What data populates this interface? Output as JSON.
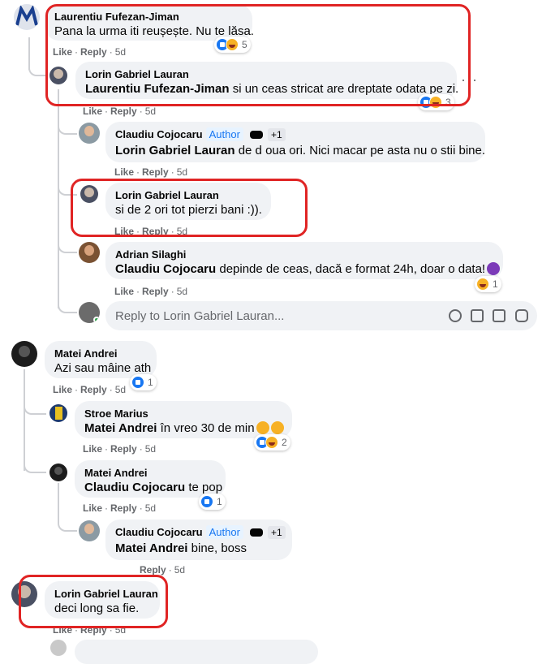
{
  "common": {
    "like": "Like",
    "reply": "Reply",
    "dot": "·"
  },
  "comments": [
    {
      "name": "Laurentiu Fufezan-Jiman",
      "text": "Pana la urma iti reușește. Nu te lăsa.",
      "time": "5d",
      "reactions": "5"
    },
    {
      "name": "Lorin Gabriel Lauran",
      "tag": "Laurentiu Fufezan-Jiman",
      "text": "si un ceas stricat are dreptate odata pe zi.",
      "time": "5d",
      "reactions": "3"
    },
    {
      "name": "Claudiu Cojocaru",
      "author": "Author",
      "badge": "+1",
      "tag": "Lorin Gabriel Lauran",
      "text": "de d oua ori. Nici macar pe asta nu o stii bine.",
      "time": "5d"
    },
    {
      "name": "Lorin Gabriel Lauran",
      "text": "si de 2 ori tot pierzi bani :)).",
      "time": "5d"
    },
    {
      "name": "Adrian Silaghi",
      "tag": "Claudiu Cojocaru",
      "text": "depinde de ceas, dacă e format 24h, doar o data!",
      "time": "5d",
      "reactions": "1"
    },
    {
      "name": "Matei Andrei",
      "text": "Azi sau mâine ath",
      "time": "5d",
      "reactions": "1"
    },
    {
      "name": "Stroe Marius",
      "tag": "Matei Andrei",
      "text": "în vreo 30 de min",
      "time": "5d",
      "reactions": "2"
    },
    {
      "name": "Matei Andrei",
      "tag": "Claudiu Cojocaru",
      "text": "te pop",
      "time": "5d",
      "reactions": "1"
    },
    {
      "name": "Claudiu Cojocaru",
      "author": "Author",
      "badge": "+1",
      "tag": "Matei Andrei",
      "text": "bine, boss",
      "time": "5d"
    },
    {
      "name": "Lorin Gabriel Lauran",
      "text": "deci long sa fie.",
      "time": "5d"
    }
  ],
  "reply_box": {
    "placeholder": "Reply to Lorin Gabriel Lauran..."
  },
  "colors": {
    "highlight": "#e02424",
    "author_badge": "#1877f2",
    "bubble": "#f0f2f5",
    "meta": "#65676b"
  }
}
